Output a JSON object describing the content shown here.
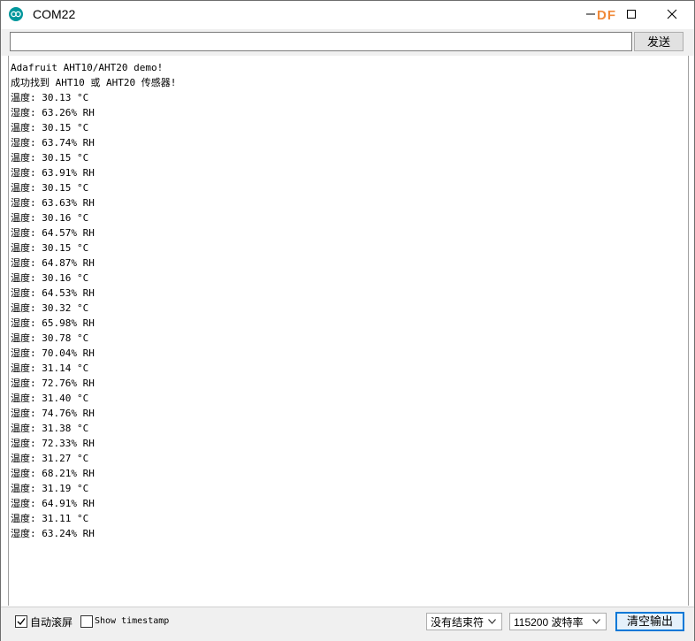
{
  "window": {
    "title": "COM22",
    "watermark": "DF",
    "accent": "#00979c"
  },
  "send_bar": {
    "input_value": "",
    "send_label": "发送"
  },
  "output": {
    "lines": [
      "Adafruit AHT10/AHT20 demo!",
      "成功找到 AHT10 或 AHT20 传感器!",
      "温度: 30.13 °C",
      "湿度: 63.26% RH",
      "温度: 30.15 °C",
      "湿度: 63.74% RH",
      "温度: 30.15 °C",
      "湿度: 63.91% RH",
      "温度: 30.15 °C",
      "湿度: 63.63% RH",
      "温度: 30.16 °C",
      "湿度: 64.57% RH",
      "温度: 30.15 °C",
      "湿度: 64.87% RH",
      "温度: 30.16 °C",
      "湿度: 64.53% RH",
      "温度: 30.32 °C",
      "湿度: 65.98% RH",
      "温度: 30.78 °C",
      "湿度: 70.04% RH",
      "温度: 31.14 °C",
      "湿度: 72.76% RH",
      "温度: 31.40 °C",
      "湿度: 74.76% RH",
      "温度: 31.38 °C",
      "湿度: 72.33% RH",
      "温度: 31.27 °C",
      "湿度: 68.21% RH",
      "温度: 31.19 °C",
      "湿度: 64.91% RH",
      "温度: 31.11 °C",
      "湿度: 63.24% RH"
    ]
  },
  "statusbar": {
    "autoscroll_label": "自动滚屏",
    "autoscroll_checked": true,
    "timestamp_label": "Show timestamp",
    "timestamp_checked": false,
    "line_ending": "没有结束符",
    "baud_rate": "115200 波特率",
    "clear_label": "清空输出"
  }
}
